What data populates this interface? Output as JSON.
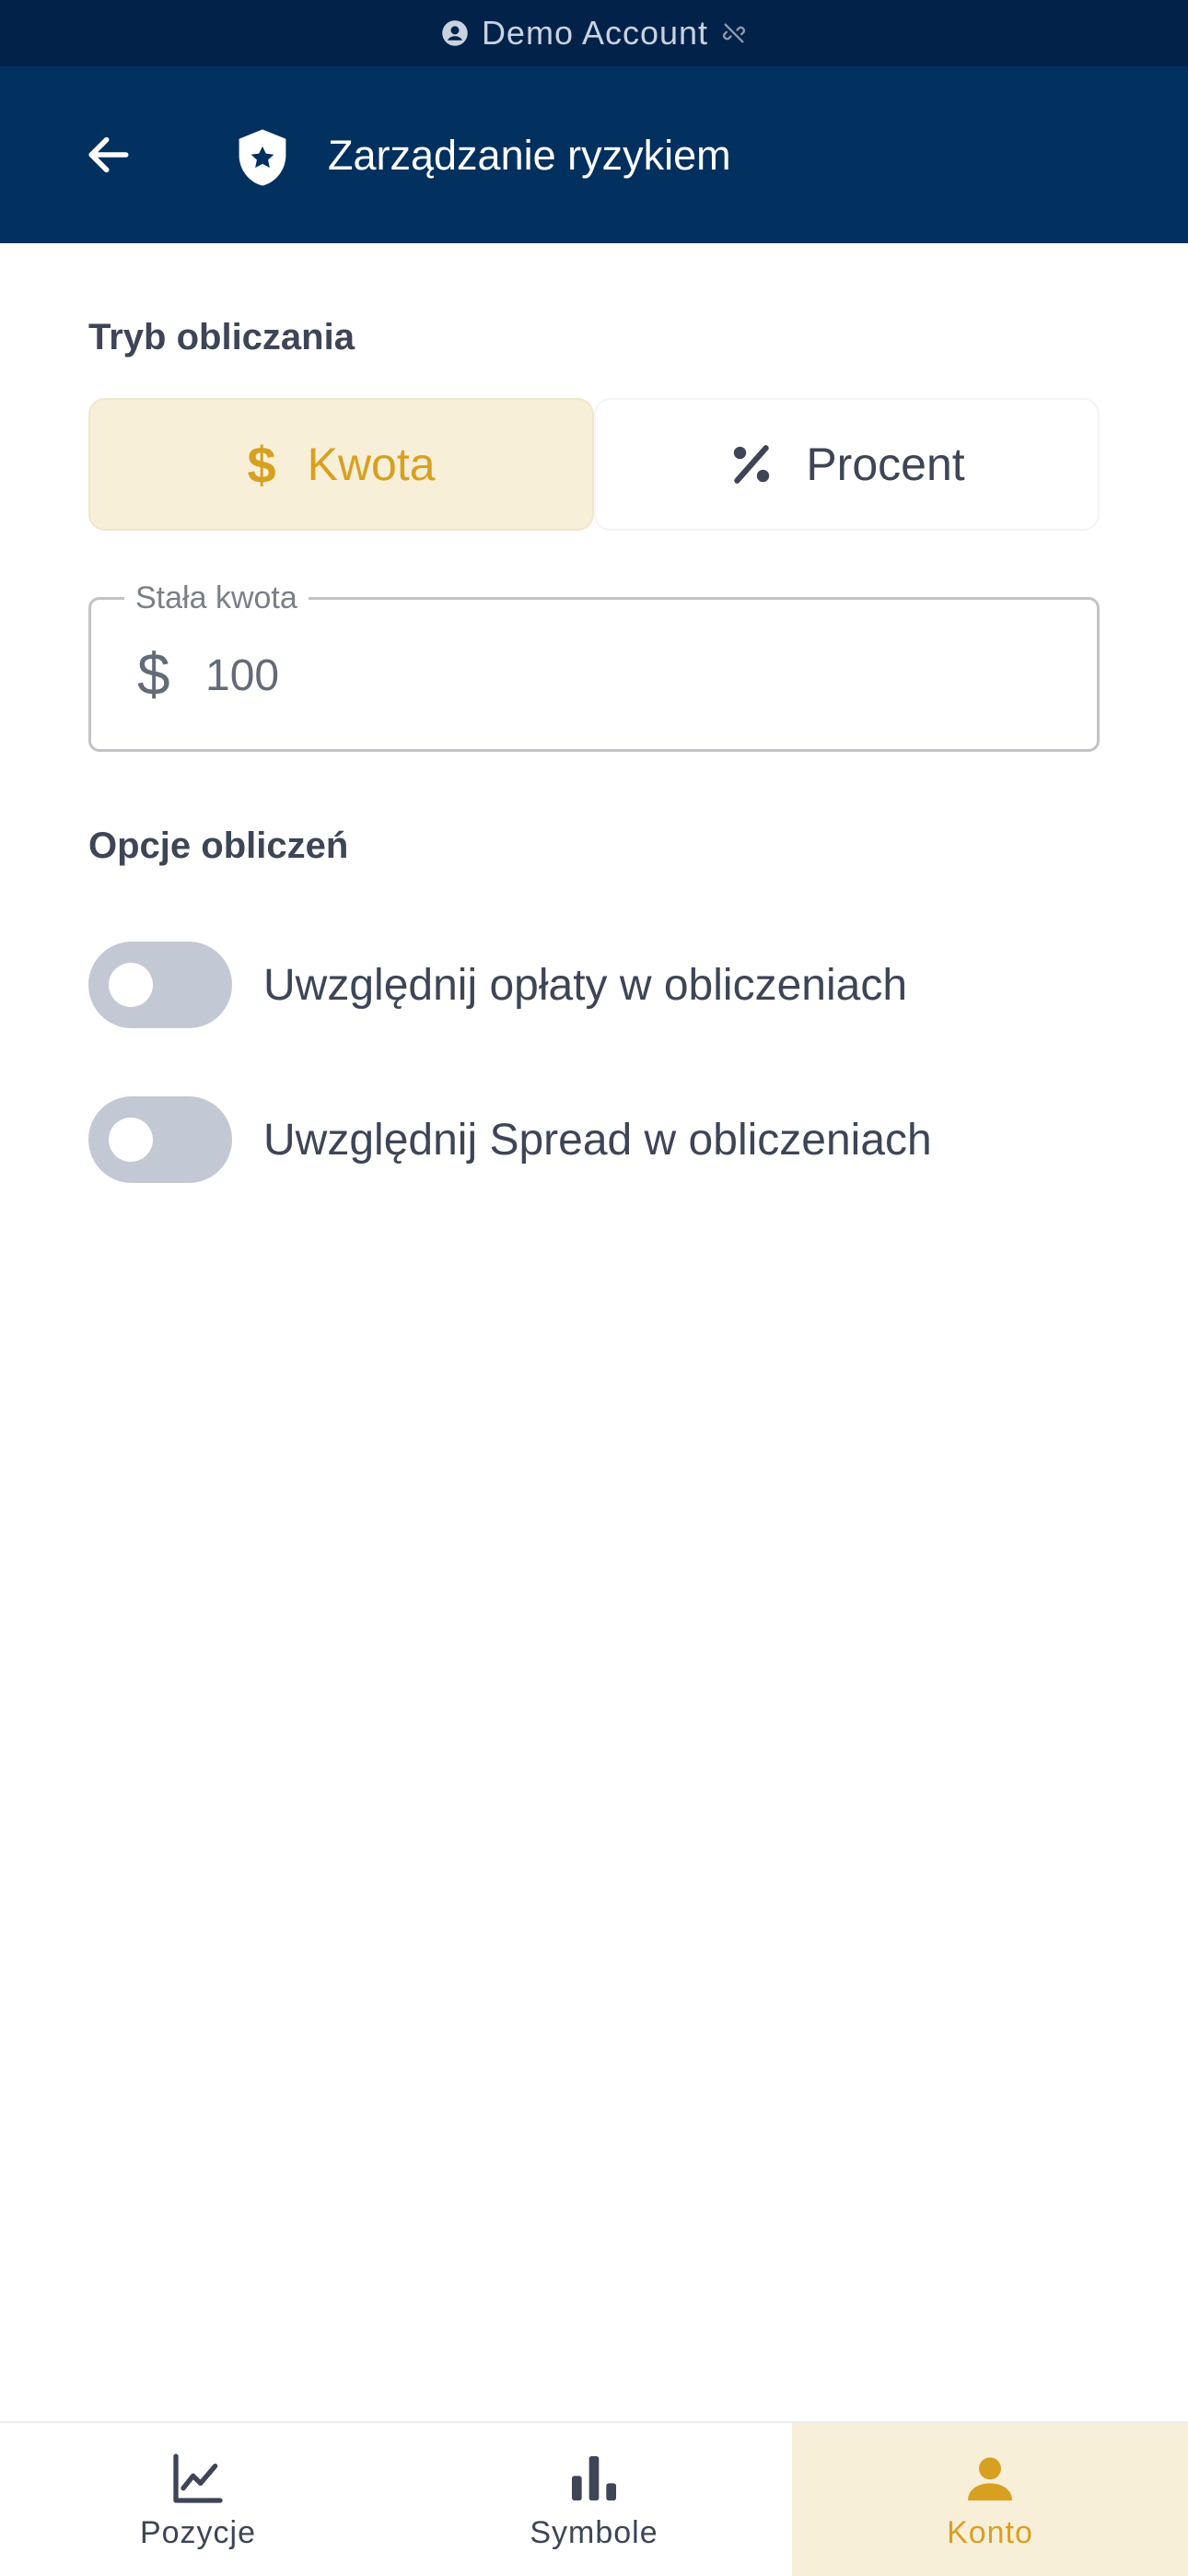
{
  "status_banner": {
    "text": "Demo Account"
  },
  "header": {
    "title": "Zarządzanie ryzykiem"
  },
  "calc_mode": {
    "label": "Tryb obliczania",
    "options": [
      {
        "symbol": "$",
        "label": "Kwota",
        "selected": true
      },
      {
        "symbol": "%",
        "label": "Procent",
        "selected": false
      }
    ]
  },
  "fixed_amount": {
    "label": "Stała kwota",
    "prefix": "$",
    "value": "100"
  },
  "calc_options": {
    "label": "Opcje obliczeń",
    "toggles": [
      {
        "label": "Uwzględnij opłaty w obliczeniach",
        "on": false
      },
      {
        "label": "Uwzględnij Spread w obliczeniach",
        "on": false
      }
    ]
  },
  "bottom_nav": {
    "items": [
      {
        "label": "Pozycje",
        "icon": "line-chart-icon",
        "active": false
      },
      {
        "label": "Symbole",
        "icon": "bar-chart-icon",
        "active": false
      },
      {
        "label": "Konto",
        "icon": "person-icon",
        "active": true
      }
    ]
  },
  "colors": {
    "banner_bg": "#02224a",
    "header_bg": "#02305f",
    "accent": "#d8a021",
    "accent_bg": "#f8efd9",
    "toggle_off": "#c2c8d4"
  }
}
